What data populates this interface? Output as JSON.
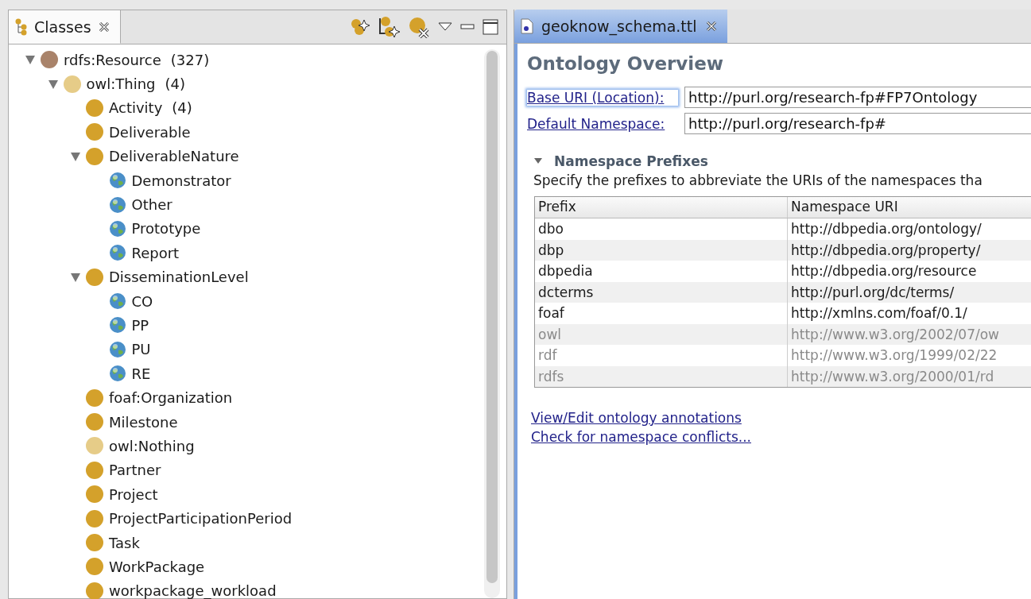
{
  "classes_view": {
    "tab": {
      "label": "Classes",
      "selected": true
    },
    "tree": [
      {
        "label": "rdfs:Resource",
        "count": "(327)",
        "kind": "root",
        "expanded": true,
        "children": [
          {
            "label": "owl:Thing",
            "count": "(4)",
            "kind": "thing",
            "expanded": true,
            "children": [
              {
                "label": "Activity",
                "count": "(4)",
                "kind": "class"
              },
              {
                "label": "Deliverable",
                "kind": "class"
              },
              {
                "label": "DeliverableNature",
                "kind": "class",
                "expanded": true,
                "children": [
                  {
                    "label": "Demonstrator",
                    "kind": "individual"
                  },
                  {
                    "label": "Other",
                    "kind": "individual"
                  },
                  {
                    "label": "Prototype",
                    "kind": "individual"
                  },
                  {
                    "label": "Report",
                    "kind": "individual"
                  }
                ]
              },
              {
                "label": "DisseminationLevel",
                "kind": "class",
                "expanded": true,
                "children": [
                  {
                    "label": "CO",
                    "kind": "individual"
                  },
                  {
                    "label": "PP",
                    "kind": "individual"
                  },
                  {
                    "label": "PU",
                    "kind": "individual"
                  },
                  {
                    "label": "RE",
                    "kind": "individual"
                  }
                ]
              },
              {
                "label": "foaf:Organization",
                "kind": "class"
              },
              {
                "label": "Milestone",
                "kind": "class"
              },
              {
                "label": "owl:Nothing",
                "kind": "thing"
              },
              {
                "label": "Partner",
                "kind": "class"
              },
              {
                "label": "Project",
                "kind": "class"
              },
              {
                "label": "ProjectParticipationPeriod",
                "kind": "class"
              },
              {
                "label": "Task",
                "kind": "class"
              },
              {
                "label": "WorkPackage",
                "kind": "class"
              },
              {
                "label": "workpackage_workload",
                "kind": "class"
              }
            ]
          }
        ]
      }
    ]
  },
  "editor": {
    "tab": {
      "label": "geoknow_schema.ttl",
      "selected": true
    },
    "title": "Ontology Overview",
    "fields": [
      {
        "label": "Base URI (Location):",
        "value": "http://purl.org/research-fp#FP7Ontology",
        "focused": true
      },
      {
        "label": "Default Namespace:",
        "value": "http://purl.org/research-fp#",
        "focused": false
      }
    ],
    "section": {
      "title": "Namespace Prefixes",
      "expanded": true,
      "description": "Specify the prefixes to abbreviate the URIs of the namespaces tha"
    },
    "table": {
      "columns": [
        "Prefix",
        "Namespace URI"
      ],
      "rows": [
        {
          "prefix": "dbo",
          "uri": "http://dbpedia.org/ontology/",
          "disabled": false
        },
        {
          "prefix": "dbp",
          "uri": "http://dbpedia.org/property/",
          "disabled": false
        },
        {
          "prefix": "dbpedia",
          "uri": "http://dbpedia.org/resource",
          "disabled": false
        },
        {
          "prefix": "dcterms",
          "uri": "http://purl.org/dc/terms/",
          "disabled": false
        },
        {
          "prefix": "foaf",
          "uri": "http://xmlns.com/foaf/0.1/",
          "disabled": false
        },
        {
          "prefix": "owl",
          "uri": "http://www.w3.org/2002/07/ow",
          "disabled": true
        },
        {
          "prefix": "rdf",
          "uri": "http://www.w3.org/1999/02/22",
          "disabled": true
        },
        {
          "prefix": "rdfs",
          "uri": "http://www.w3.org/2000/01/rd",
          "disabled": true
        }
      ]
    },
    "links": [
      "View/Edit ontology annotations",
      "Check for namespace conflicts..."
    ]
  }
}
